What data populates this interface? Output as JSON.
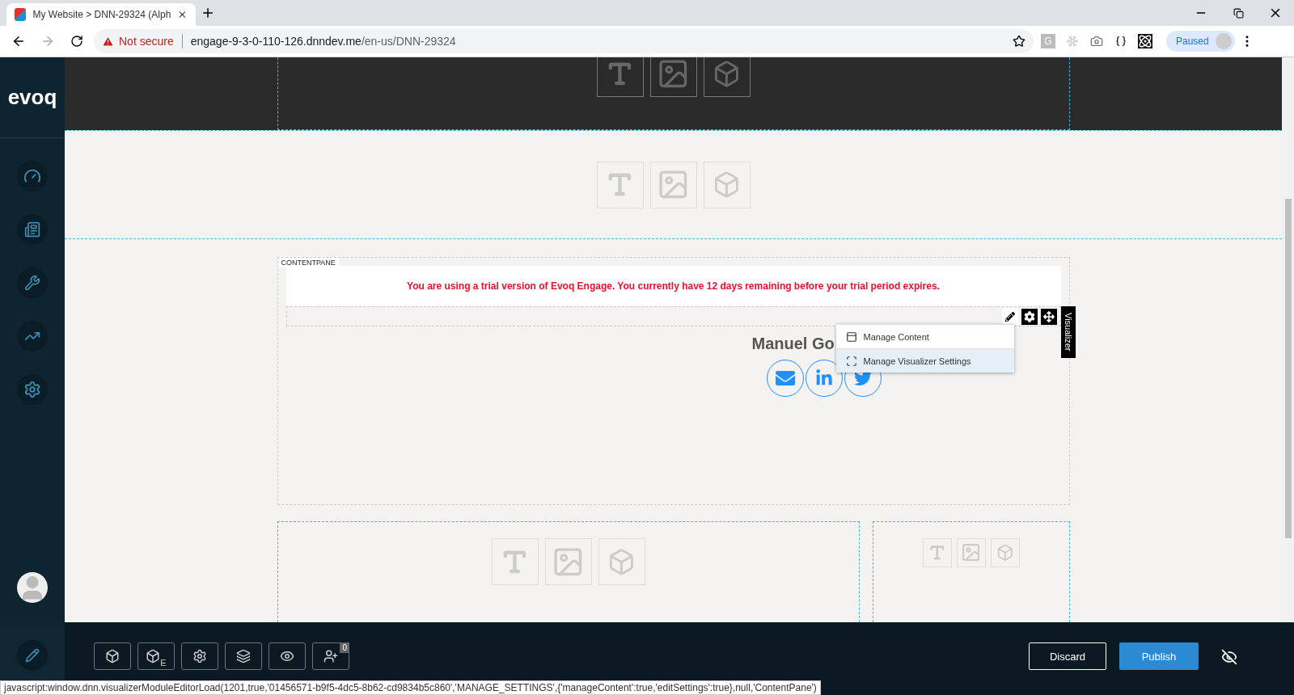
{
  "browser": {
    "tab_title": "My Website > DNN-29324 (Alph",
    "security": "Not secure",
    "url_host": "engage-9-3-0-110-126.dnndev.me",
    "url_path": "/en-us/DNN-29324",
    "extension_letter": "G",
    "profile": "Paused"
  },
  "sidebar": {
    "logo": "evoq"
  },
  "content_pane": {
    "label": "CONTENTPANE",
    "notice": "You are using a trial version of Evoq Engage. You currently have 12 days remaining before your trial period expires.",
    "module_name": "Manuel Go",
    "module_tab": "Visualizer",
    "menu": [
      {
        "label": "Manage Content",
        "kind": "content",
        "selected": false
      },
      {
        "label": "Manage Visualizer Settings",
        "kind": "settings",
        "selected": true
      }
    ]
  },
  "footer": {
    "subscript": "E",
    "badge": "0",
    "discard": "Discard",
    "publish": "Publish"
  },
  "status_bar": "javascript:window.dnn.visualizerModuleEditorLoad(1201,true,'01456571-b9f5-4dc5-8b62-cd9834b5c860','MANAGE_SETTINGS',{'manageContent':true,'editSettings':true},null,'ContentPane')"
}
